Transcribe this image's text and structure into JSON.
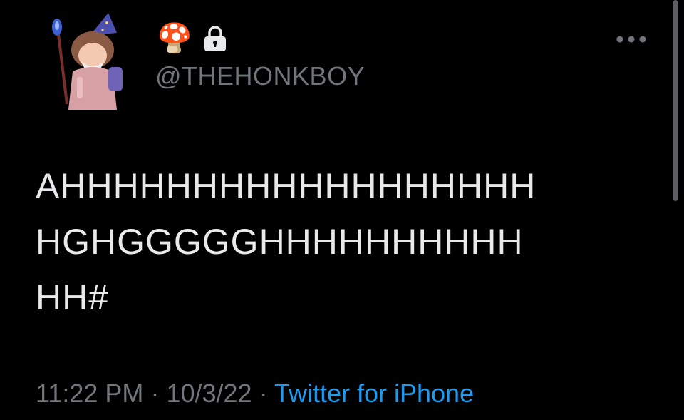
{
  "tweet": {
    "avatar_icon": "wizard-avatar",
    "display_name_emoji": "🍄",
    "lock_icon": "lock-icon",
    "handle": "@THEHONKBOY",
    "more_icon": "more-horizontal-icon",
    "text_lines": [
      "AHHHHHHHHHHHHHHHHHH",
      "HGHGGGGGHHHHHHHHHH",
      "HH#"
    ],
    "time": "11:22 PM",
    "separator": "·",
    "date": "10/3/22",
    "source": "Twitter for iPhone"
  },
  "colors": {
    "background": "#000000",
    "primary_text": "#e7e9ea",
    "secondary_text": "#71767b",
    "link": "#1d9bf0"
  }
}
